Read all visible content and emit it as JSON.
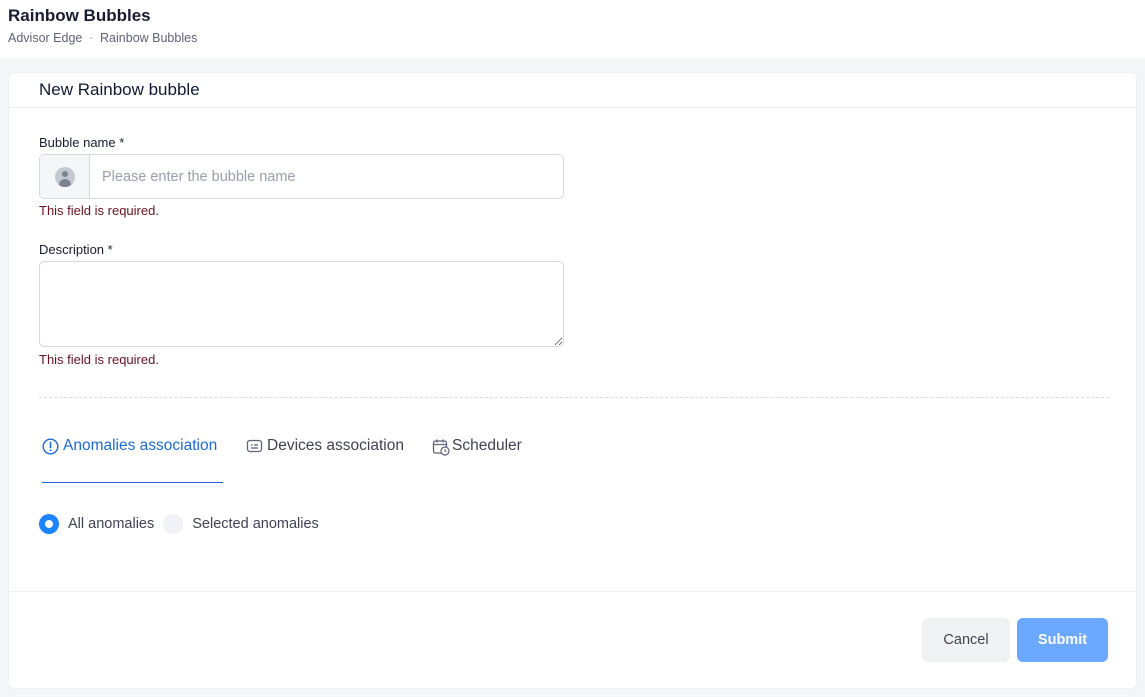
{
  "header": {
    "title": "Rainbow Bubbles",
    "breadcrumb": [
      "Advisor Edge",
      "Rainbow Bubbles"
    ],
    "breadcrumb_separator": "-"
  },
  "form": {
    "title": "New Rainbow bubble",
    "bubble_name": {
      "label": "Bubble name *",
      "placeholder": "Please enter the bubble name",
      "value": "",
      "error": "This field is required."
    },
    "description": {
      "label": "Description *",
      "value": "",
      "error": "This field is required."
    }
  },
  "tabs": [
    {
      "label": "Anomalies association",
      "icon": "info-circle-icon",
      "active": true
    },
    {
      "label": "Devices association",
      "icon": "device-icon",
      "active": false
    },
    {
      "label": "Scheduler",
      "icon": "calendar-clock-icon",
      "active": false
    }
  ],
  "radios": [
    {
      "label": "All anomalies",
      "checked": true
    },
    {
      "label": "Selected anomalies",
      "checked": false
    }
  ],
  "buttons": {
    "cancel": "Cancel",
    "submit": "Submit"
  },
  "colors": {
    "accent": "#1b6ad8",
    "radio_checked": "#1b84ff",
    "submit_bg": "#6aa9ff",
    "error_text": "#6b1222"
  }
}
